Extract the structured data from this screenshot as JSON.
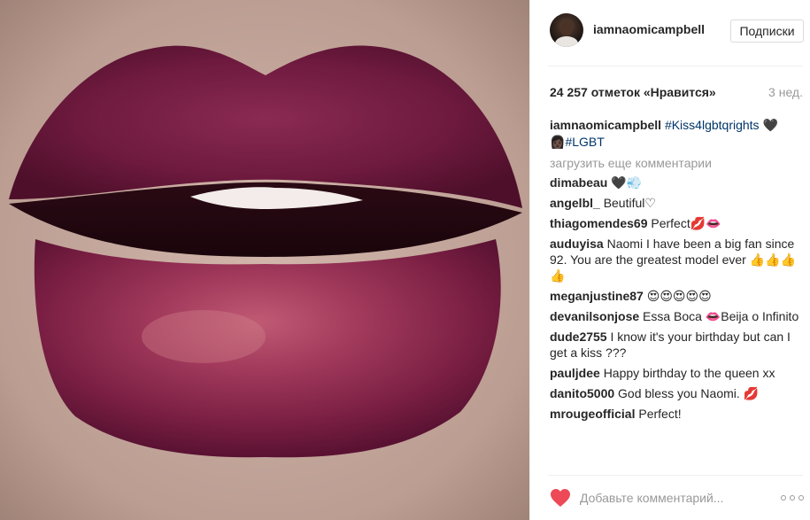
{
  "post": {
    "username": "iamnaomicampbell",
    "follow_label": "Подписки",
    "likes": "24 257 отметок «Нравится»",
    "posted_ago": "3 нед."
  },
  "caption": {
    "author": "iamnaomicampbell",
    "hashtag_1": "#Kiss4lgbtqrights",
    "emoji_1": "🖤",
    "emoji_2": "👩🏿",
    "hashtag_2": "#LGBT"
  },
  "load_more_label": "загрузить еще комментарии",
  "comments": [
    {
      "author": "dimabeau",
      "text": "🖤💨"
    },
    {
      "author": "angelbl_",
      "text": "Beutiful♡"
    },
    {
      "author": "thiagomendes69",
      "text": "Perfect💋👄"
    },
    {
      "author": "auduyisa",
      "text": "Naomi I have been a big fan since 92. You are the greatest model ever 👍👍👍👍"
    },
    {
      "author": "meganjustine87",
      "text": "😍😍😍😍😍"
    },
    {
      "author": "devanilsonjose",
      "text": "Essa Boca 👄Beija o Infinito"
    },
    {
      "author": "dude2755",
      "text": "I know it's your birthday but can I get a kiss ???"
    },
    {
      "author": "pauljdee",
      "text": "Happy birthday to the queen xx"
    },
    {
      "author": "danito5000",
      "text": "God bless you Naomi. 💋"
    },
    {
      "author": "mrougeofficial",
      "text": "Perfect!"
    }
  ],
  "footer": {
    "comment_placeholder": "Добавьте комментарий...",
    "heart_color": "#ed4956"
  },
  "icons": {
    "like": "heart-icon",
    "more": "more-options-icon"
  }
}
